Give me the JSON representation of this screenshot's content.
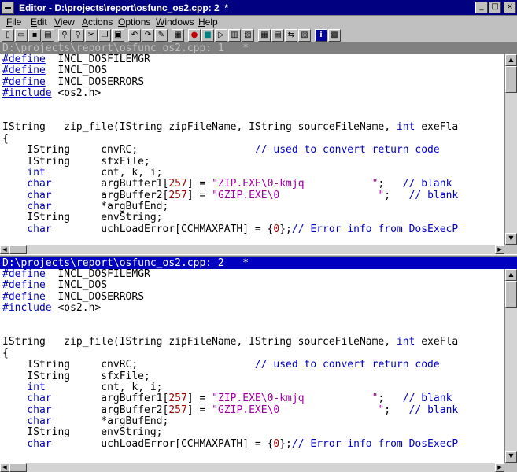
{
  "window": {
    "title": "Editor - D:\\projects\\report\\osfunc_os2.cpp: 2",
    "title_marker": "*",
    "min_glyph": "_",
    "max_glyph": "□",
    "close_glyph": "×"
  },
  "menu": [
    {
      "label": "File",
      "ul": "F",
      "rest": "ile"
    },
    {
      "label": "Edit",
      "ul": "E",
      "rest": "dit"
    },
    {
      "label": "View",
      "ul": "V",
      "rest": "iew"
    },
    {
      "label": "Actions",
      "ul": "A",
      "rest": "ctions"
    },
    {
      "label": "Options",
      "ul": "O",
      "rest": "ptions"
    },
    {
      "label": "Windows",
      "ul": "W",
      "rest": "indows"
    },
    {
      "label": "Help",
      "ul": "H",
      "rest": "elp"
    }
  ],
  "toolbar": [
    {
      "icon": "new-file-icon",
      "glyph": "▯"
    },
    {
      "icon": "open-folder-icon",
      "glyph": "▭"
    },
    {
      "icon": "save-icon",
      "glyph": "▪"
    },
    {
      "icon": "print-icon",
      "glyph": "▤"
    },
    {
      "icon": "find-icon",
      "glyph": "⚲"
    },
    {
      "icon": "find-next-icon",
      "glyph": "⚲"
    },
    {
      "icon": "cut-icon",
      "glyph": "✂"
    },
    {
      "icon": "copy-icon",
      "glyph": "❐"
    },
    {
      "icon": "paste-icon",
      "glyph": "▣"
    },
    {
      "icon": "undo-icon",
      "glyph": "↶"
    },
    {
      "icon": "redo-icon",
      "glyph": "↷"
    },
    {
      "icon": "marker-icon",
      "glyph": "✎"
    },
    {
      "icon": "calculator-icon",
      "glyph": "▦"
    },
    {
      "icon": "record-macro-icon",
      "glyph": "●"
    },
    {
      "icon": "stop-macro-icon",
      "glyph": "■"
    },
    {
      "icon": "play-macro-icon",
      "glyph": "▷"
    },
    {
      "icon": "window-list-icon",
      "glyph": "▥"
    },
    {
      "icon": "dialog-icon",
      "glyph": "▨"
    },
    {
      "icon": "tile-icon",
      "glyph": "▦"
    },
    {
      "icon": "cascade-icon",
      "glyph": "▤"
    },
    {
      "icon": "compare-icon",
      "glyph": "⇆"
    },
    {
      "icon": "split-icon",
      "glyph": "▧"
    },
    {
      "icon": "info-icon",
      "glyph": "i"
    },
    {
      "icon": "help-book-icon",
      "glyph": "▩"
    }
  ],
  "panes": [
    {
      "title": "D:\\projects\\report\\osfunc_os2.cpp: 1",
      "marker": "*",
      "active": false,
      "lines": [
        [
          [
            "kw-u",
            "#define"
          ],
          [
            "",
            "  INCL_DOSFILEMGR"
          ]
        ],
        [
          [
            "kw-u",
            "#define"
          ],
          [
            "",
            "  INCL_DOS"
          ]
        ],
        [
          [
            "kw-u",
            "#define"
          ],
          [
            "",
            "  INCL_DOSERRORS"
          ]
        ],
        [
          [
            "kw-u",
            "#include"
          ],
          [
            "",
            " <os2.h>"
          ]
        ],
        [
          [
            "",
            ""
          ]
        ],
        [
          [
            "",
            ""
          ]
        ],
        [
          [
            "",
            "IString   zip_file(IString zipFileName, IString sourceFileName, "
          ],
          [
            "kw",
            "int"
          ],
          [
            "",
            " exeFla"
          ]
        ],
        [
          [
            "",
            "{"
          ]
        ],
        [
          [
            "",
            "    IString     cnvRC;                   "
          ],
          [
            "cm",
            "// used to convert return code"
          ]
        ],
        [
          [
            "",
            "    IString     sfxFile;"
          ]
        ],
        [
          [
            "kw",
            "    int"
          ],
          [
            "",
            "         cnt, k, i;"
          ]
        ],
        [
          [
            "kw",
            "    char"
          ],
          [
            "",
            "        argBuffer1["
          ],
          [
            "num",
            "257"
          ],
          [
            "",
            "] = "
          ],
          [
            "str",
            "\"ZIP.EXE\\0-kmjq           \""
          ],
          [
            "",
            ";   "
          ],
          [
            "cm",
            "// blank"
          ]
        ],
        [
          [
            "kw",
            "    char"
          ],
          [
            "",
            "        argBuffer2["
          ],
          [
            "num",
            "257"
          ],
          [
            "",
            "] = "
          ],
          [
            "str",
            "\"GZIP.EXE\\0                \""
          ],
          [
            "",
            ";   "
          ],
          [
            "cm",
            "// blank"
          ]
        ],
        [
          [
            "kw",
            "    char"
          ],
          [
            "",
            "        *argBufEnd;"
          ]
        ],
        [
          [
            "",
            "    IString     envString;"
          ]
        ],
        [
          [
            "kw",
            "    char"
          ],
          [
            "",
            "        uchLoadError[CCHMAXPATH] = {"
          ],
          [
            "num",
            "0"
          ],
          [
            "",
            "};"
          ],
          [
            "cm",
            "// Error info from DosExecP"
          ]
        ]
      ]
    },
    {
      "title": "D:\\projects\\report\\osfunc_os2.cpp: 2",
      "marker": "*",
      "active": true,
      "lines": [
        [
          [
            "kw-u",
            "#define"
          ],
          [
            "",
            "  INCL_DOSFILEMGR"
          ]
        ],
        [
          [
            "kw-u",
            "#define"
          ],
          [
            "",
            "  INCL_DOS"
          ]
        ],
        [
          [
            "kw-u",
            "#define"
          ],
          [
            "",
            "  INCL_DOSERRORS"
          ]
        ],
        [
          [
            "kw-u",
            "#include"
          ],
          [
            "",
            " <os2.h>"
          ]
        ],
        [
          [
            "",
            ""
          ]
        ],
        [
          [
            "",
            ""
          ]
        ],
        [
          [
            "",
            "IString   zip_file(IString zipFileName, IString sourceFileName, "
          ],
          [
            "kw",
            "int"
          ],
          [
            "",
            " exeFla"
          ]
        ],
        [
          [
            "",
            "{"
          ]
        ],
        [
          [
            "",
            "    IString     cnvRC;                   "
          ],
          [
            "cm",
            "// used to convert return code"
          ]
        ],
        [
          [
            "",
            "    IString     sfxFile;"
          ]
        ],
        [
          [
            "kw",
            "    int"
          ],
          [
            "",
            "         cnt, k, i;"
          ]
        ],
        [
          [
            "kw",
            "    char"
          ],
          [
            "",
            "        argBuffer1["
          ],
          [
            "num",
            "257"
          ],
          [
            "",
            "] = "
          ],
          [
            "str",
            "\"ZIP.EXE\\0-kmjq           \""
          ],
          [
            "",
            ";   "
          ],
          [
            "cm",
            "// blank"
          ]
        ],
        [
          [
            "kw",
            "    char"
          ],
          [
            "",
            "        argBuffer2["
          ],
          [
            "num",
            "257"
          ],
          [
            "",
            "] = "
          ],
          [
            "str",
            "\"GZIP.EXE\\0                \""
          ],
          [
            "",
            ";   "
          ],
          [
            "cm",
            "// blank"
          ]
        ],
        [
          [
            "kw",
            "    char"
          ],
          [
            "",
            "        *argBufEnd;"
          ]
        ],
        [
          [
            "",
            "    IString     envString;"
          ]
        ],
        [
          [
            "kw",
            "    char"
          ],
          [
            "",
            "        uchLoadError[CCHMAXPATH] = {"
          ],
          [
            "num",
            "0"
          ],
          [
            "",
            "};"
          ],
          [
            "cm",
            "// Error info from DosExecP"
          ]
        ]
      ]
    }
  ],
  "scroll": {
    "up_glyph": "▲",
    "down_glyph": "▼",
    "left_glyph": "◀",
    "right_glyph": "▶"
  }
}
